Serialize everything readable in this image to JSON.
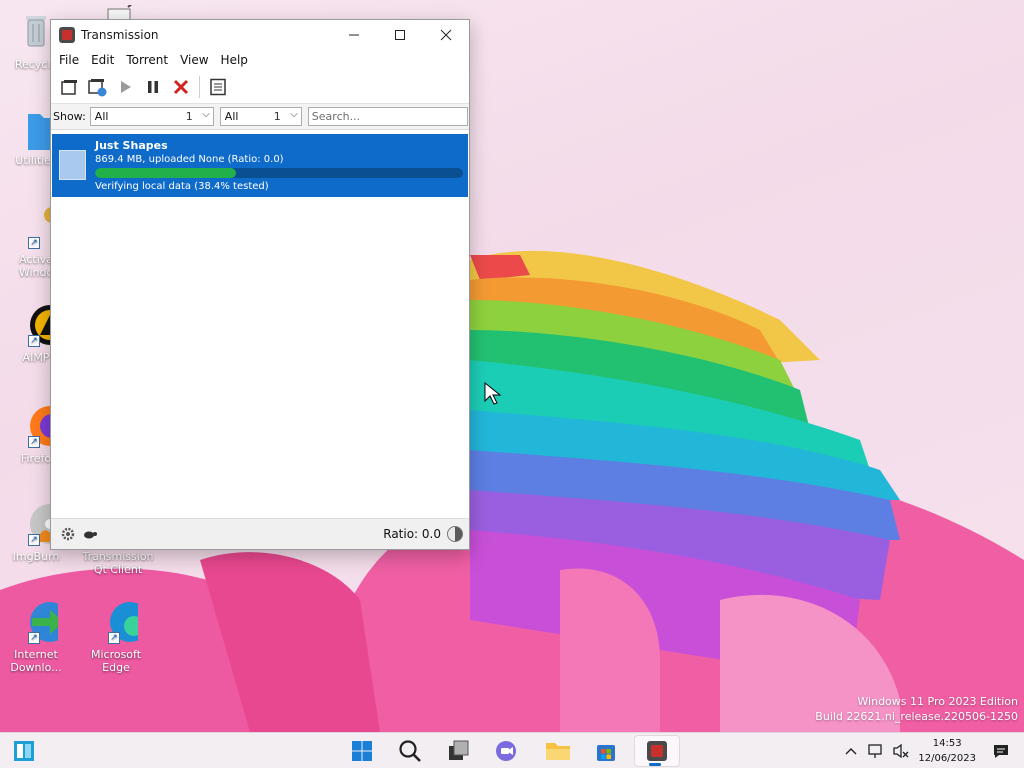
{
  "desktop": {
    "icons": [
      {
        "label": "Recycle"
      },
      {
        "label": "Utilities"
      },
      {
        "label": "Activa\nWindo"
      },
      {
        "label": "AIMP"
      },
      {
        "label": "Firefo"
      },
      {
        "label": "ImgBurn"
      },
      {
        "label": "Transmission\nQt Client"
      },
      {
        "label": "Internet\nDownlo..."
      },
      {
        "label": "Microsoft\nEdge"
      }
    ],
    "watermark_line1": "Windows 11 Pro 2023 Edition",
    "watermark_line2": "Build 22621.ni_release.220506-1250"
  },
  "window": {
    "title": "Transmission",
    "menu": [
      "File",
      "Edit",
      "Torrent",
      "View",
      "Help"
    ],
    "filter": {
      "show_label": "Show:",
      "activity": {
        "value": "All",
        "count": "1"
      },
      "tracker": {
        "value": "All",
        "count": "1"
      },
      "search_placeholder": "Search..."
    },
    "torrent": {
      "name": "Just Shapes",
      "info": "869.4 MB, uploaded None (Ratio: 0.0)",
      "status": "Verifying local data (38.4% tested)",
      "progress_percent": 38.4
    },
    "statusbar": {
      "ratio": "Ratio: 0.0"
    }
  },
  "taskbar": {
    "time": "14:53",
    "date": "12/06/2023"
  },
  "colors": {
    "selection": "#0f6bc9",
    "progress": "#22b04b",
    "accent": "#0f6bc9"
  }
}
